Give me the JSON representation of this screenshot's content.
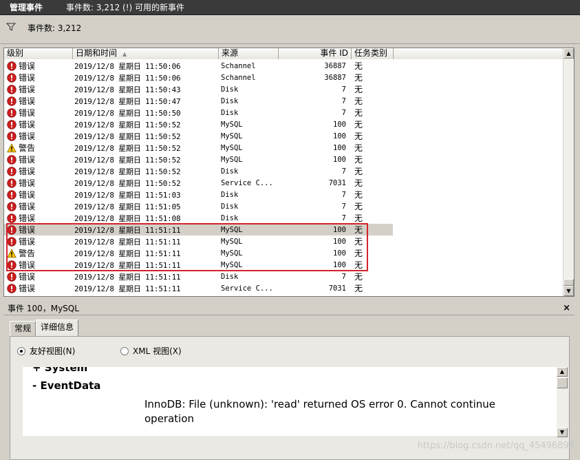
{
  "window": {
    "title": "管理事件",
    "subtitle": "事件数: 3,212 (!) 可用的新事件"
  },
  "filter": {
    "icon": "filter-icon",
    "text": "事件数: 3,212"
  },
  "columns": {
    "level": "级别",
    "datetime": "日期和时间",
    "source": "来源",
    "event_id": "事件 ID",
    "task": "任务类别"
  },
  "events": [
    {
      "level": "错误",
      "type": "error",
      "datetime": "2019/12/8 星期日 11:50:06",
      "source": "Schannel",
      "id": "36887",
      "task": "无"
    },
    {
      "level": "错误",
      "type": "error",
      "datetime": "2019/12/8 星期日 11:50:06",
      "source": "Schannel",
      "id": "36887",
      "task": "无"
    },
    {
      "level": "错误",
      "type": "error",
      "datetime": "2019/12/8 星期日 11:50:43",
      "source": "Disk",
      "id": "7",
      "task": "无"
    },
    {
      "level": "错误",
      "type": "error",
      "datetime": "2019/12/8 星期日 11:50:47",
      "source": "Disk",
      "id": "7",
      "task": "无"
    },
    {
      "level": "错误",
      "type": "error",
      "datetime": "2019/12/8 星期日 11:50:50",
      "source": "Disk",
      "id": "7",
      "task": "无"
    },
    {
      "level": "错误",
      "type": "error",
      "datetime": "2019/12/8 星期日 11:50:52",
      "source": "MySQL",
      "id": "100",
      "task": "无"
    },
    {
      "level": "错误",
      "type": "error",
      "datetime": "2019/12/8 星期日 11:50:52",
      "source": "MySQL",
      "id": "100",
      "task": "无"
    },
    {
      "level": "警告",
      "type": "warning",
      "datetime": "2019/12/8 星期日 11:50:52",
      "source": "MySQL",
      "id": "100",
      "task": "无"
    },
    {
      "level": "错误",
      "type": "error",
      "datetime": "2019/12/8 星期日 11:50:52",
      "source": "MySQL",
      "id": "100",
      "task": "无"
    },
    {
      "level": "错误",
      "type": "error",
      "datetime": "2019/12/8 星期日 11:50:52",
      "source": "Disk",
      "id": "7",
      "task": "无"
    },
    {
      "level": "错误",
      "type": "error",
      "datetime": "2019/12/8 星期日 11:50:52",
      "source": "Service C...",
      "id": "7031",
      "task": "无"
    },
    {
      "level": "错误",
      "type": "error",
      "datetime": "2019/12/8 星期日 11:51:03",
      "source": "Disk",
      "id": "7",
      "task": "无"
    },
    {
      "level": "错误",
      "type": "error",
      "datetime": "2019/12/8 星期日 11:51:05",
      "source": "Disk",
      "id": "7",
      "task": "无"
    },
    {
      "level": "错误",
      "type": "error",
      "datetime": "2019/12/8 星期日 11:51:08",
      "source": "Disk",
      "id": "7",
      "task": "无"
    },
    {
      "level": "错误",
      "type": "error",
      "datetime": "2019/12/8 星期日 11:51:11",
      "source": "MySQL",
      "id": "100",
      "task": "无",
      "selected": true
    },
    {
      "level": "错误",
      "type": "error",
      "datetime": "2019/12/8 星期日 11:51:11",
      "source": "MySQL",
      "id": "100",
      "task": "无"
    },
    {
      "level": "警告",
      "type": "warning",
      "datetime": "2019/12/8 星期日 11:51:11",
      "source": "MySQL",
      "id": "100",
      "task": "无"
    },
    {
      "level": "错误",
      "type": "error",
      "datetime": "2019/12/8 星期日 11:51:11",
      "source": "MySQL",
      "id": "100",
      "task": "无"
    },
    {
      "level": "错误",
      "type": "error",
      "datetime": "2019/12/8 星期日 11:51:11",
      "source": "Disk",
      "id": "7",
      "task": "无"
    },
    {
      "level": "错误",
      "type": "error",
      "datetime": "2019/12/8 星期日 11:51:11",
      "source": "Service C...",
      "id": "7031",
      "task": "无"
    }
  ],
  "detail": {
    "title": "事件 100，MySQL",
    "close": "×",
    "tabs": [
      "常规",
      "详细信息"
    ],
    "view_friendly": "友好视图(N)",
    "view_xml": "XML 视图(X)",
    "system_label": "+ System",
    "eventdata_label": "-  EventData",
    "message": "InnoDB: File (unknown): 'read' returned OS error 0. Cannot continue operation"
  },
  "watermark": "https://blog.csdn.net/qq_45496894",
  "colors": {
    "error": "#cc1f1f",
    "warning": "#f5c400",
    "highlight": "#d3222a"
  }
}
